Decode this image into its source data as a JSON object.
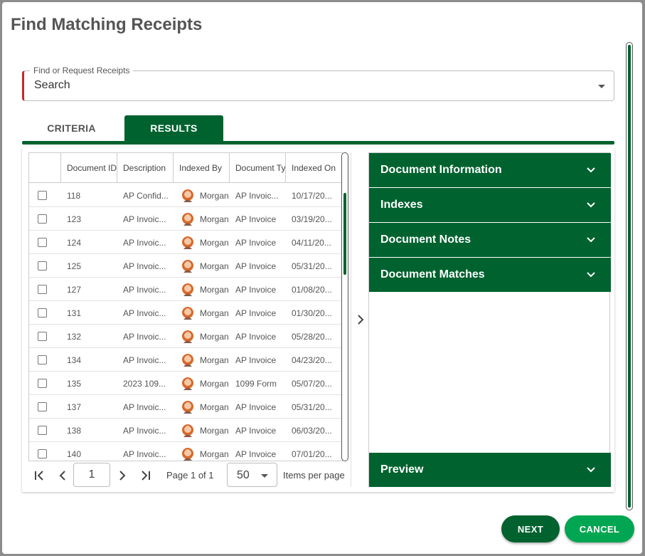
{
  "dialog": {
    "title": "Find Matching Receipts"
  },
  "search": {
    "label": "Find or Request Receipts",
    "value": "Search"
  },
  "tabs": [
    {
      "label": "CRITERIA",
      "active": false
    },
    {
      "label": "RESULTS",
      "active": true
    }
  ],
  "grid": {
    "columns": [
      "Document ID",
      "Description",
      "Indexed By",
      "Document Type",
      "Indexed On"
    ],
    "rows": [
      {
        "id": "118",
        "description": "AP Confid...",
        "indexed_by": "Morgan",
        "doc_type": "AP Invoic...",
        "indexed_on": "10/17/20..."
      },
      {
        "id": "123",
        "description": "AP Invoic...",
        "indexed_by": "Morgan",
        "doc_type": "AP Invoice",
        "indexed_on": "03/19/20..."
      },
      {
        "id": "124",
        "description": "AP Invoic...",
        "indexed_by": "Morgan",
        "doc_type": "AP Invoice",
        "indexed_on": "04/11/20..."
      },
      {
        "id": "125",
        "description": "AP Invoic...",
        "indexed_by": "Morgan",
        "doc_type": "AP Invoice",
        "indexed_on": "05/31/20..."
      },
      {
        "id": "127",
        "description": "AP Invoic...",
        "indexed_by": "Morgan",
        "doc_type": "AP Invoice",
        "indexed_on": "01/08/20..."
      },
      {
        "id": "131",
        "description": "AP Invoic...",
        "indexed_by": "Morgan",
        "doc_type": "AP Invoice",
        "indexed_on": "01/30/20..."
      },
      {
        "id": "132",
        "description": "AP Invoic...",
        "indexed_by": "Morgan",
        "doc_type": "AP Invoice",
        "indexed_on": "05/28/20..."
      },
      {
        "id": "134",
        "description": "AP Invoic...",
        "indexed_by": "Morgan",
        "doc_type": "AP Invoice",
        "indexed_on": "04/23/20..."
      },
      {
        "id": "135",
        "description": "2023 109...",
        "indexed_by": "Morgan",
        "doc_type": "1099 Form",
        "indexed_on": "05/07/20..."
      },
      {
        "id": "137",
        "description": "AP Invoic...",
        "indexed_by": "Morgan",
        "doc_type": "AP Invoice",
        "indexed_on": "05/31/20..."
      },
      {
        "id": "138",
        "description": "AP Invoic...",
        "indexed_by": "Morgan",
        "doc_type": "AP Invoice",
        "indexed_on": "06/03/20..."
      },
      {
        "id": "140",
        "description": "AP Invoic...",
        "indexed_by": "Morgan",
        "doc_type": "AP Invoice",
        "indexed_on": "07/01/20..."
      }
    ]
  },
  "pager": {
    "current_page": "1",
    "page_info": "Page 1 of 1",
    "page_size": "50",
    "items_label": "Items per page"
  },
  "panels": [
    {
      "label": "Document Information"
    },
    {
      "label": "Indexes"
    },
    {
      "label": "Document Notes"
    },
    {
      "label": "Document Matches"
    },
    {
      "label": "Preview"
    }
  ],
  "buttons": {
    "next": "NEXT",
    "cancel": "CANCEL"
  },
  "colors": {
    "primary": "#00622f",
    "accent": "#00a651",
    "required": "#c62828"
  }
}
